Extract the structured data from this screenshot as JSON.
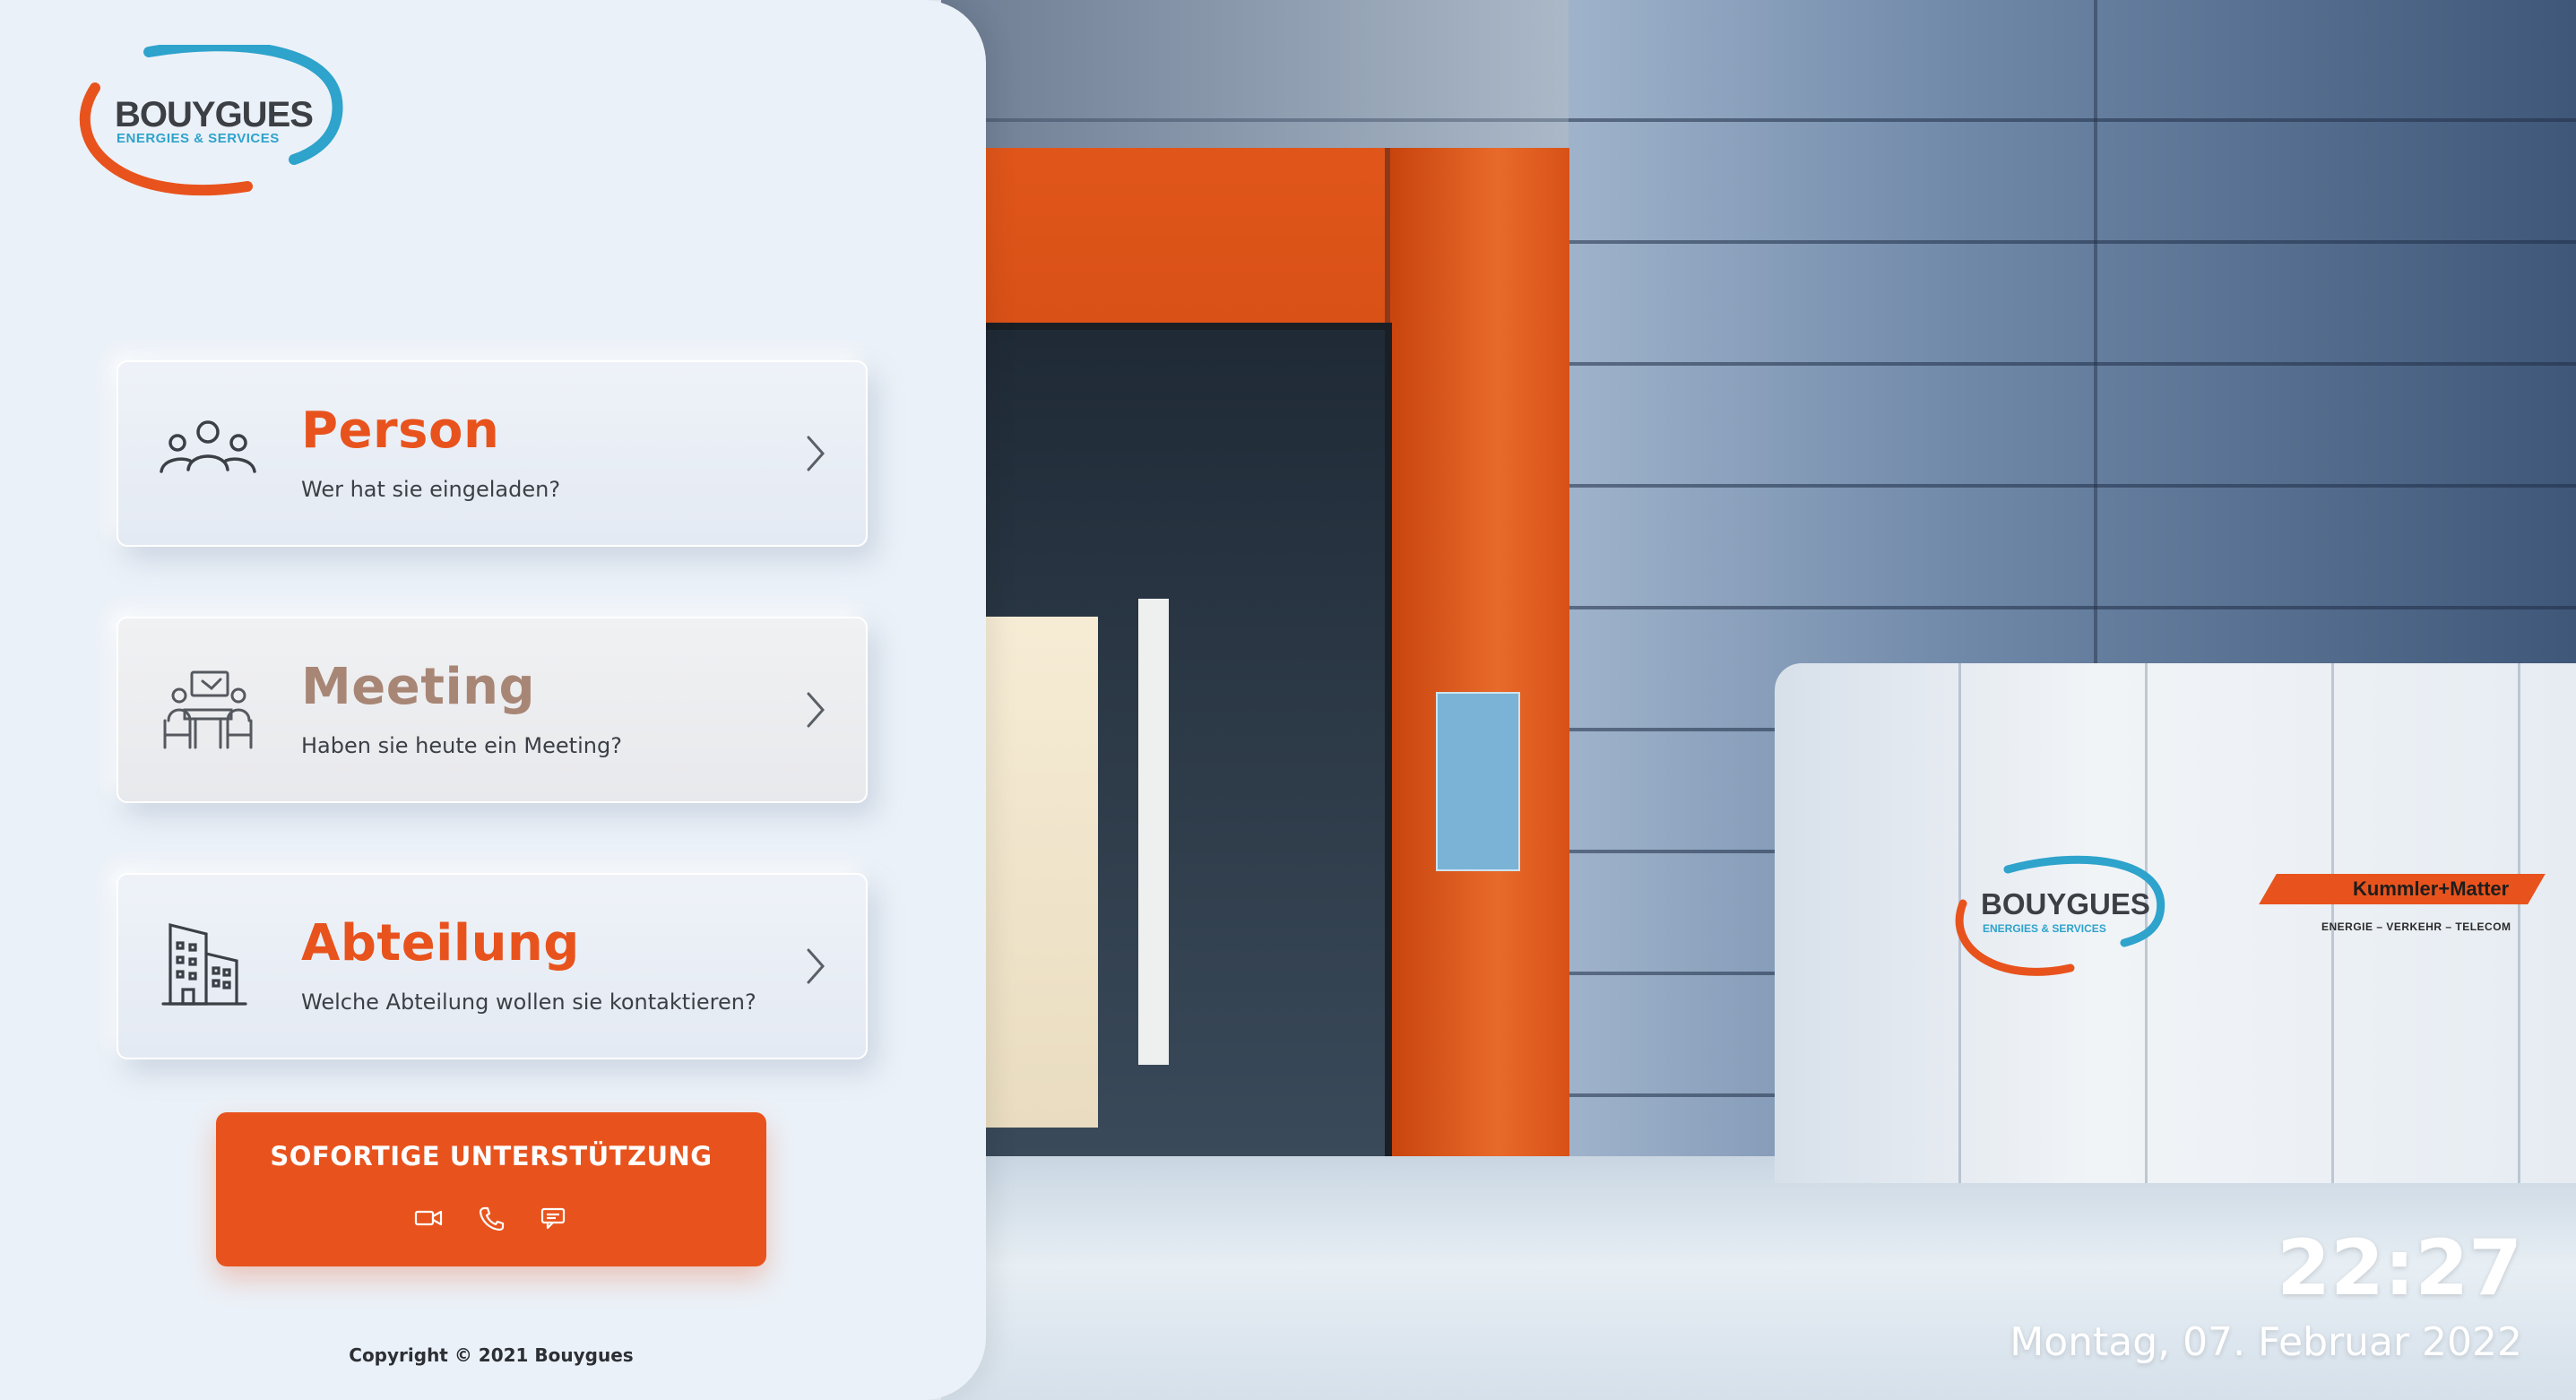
{
  "brand": {
    "name": "BOUYGUES",
    "subtitle": "ENERGIES & SERVICES",
    "colors": {
      "orange": "#e8531d",
      "blue": "#2ea3cc",
      "dark": "#3c3f44"
    }
  },
  "options": [
    {
      "title": "Person",
      "subtitle": "Wer hat sie eingeladen?",
      "icon": "people-icon"
    },
    {
      "title": "Meeting",
      "subtitle": "Haben sie heute ein Meeting?",
      "icon": "meeting-icon"
    },
    {
      "title": "Abteilung",
      "subtitle": "Welche Abteilung wollen sie kontaktieren?",
      "icon": "building-icon"
    }
  ],
  "support": {
    "label": "SOFORTIGE UNTERSTÜTZUNG",
    "icons": [
      "video-icon",
      "phone-icon",
      "chat-icon"
    ]
  },
  "footer": {
    "copyright": "Copyright © 2021 Bouygues"
  },
  "clock": {
    "time": "22:27",
    "date": "Montag, 07. Februar 2022"
  },
  "photo": {
    "desk_logo_name": "BOUYGUES",
    "desk_logo_subtitle": "ENERGIES & SERVICES",
    "partner_name": "Kummler+Matter",
    "partner_tagline": "ENERGIE – VERKEHR – TELECOM"
  }
}
